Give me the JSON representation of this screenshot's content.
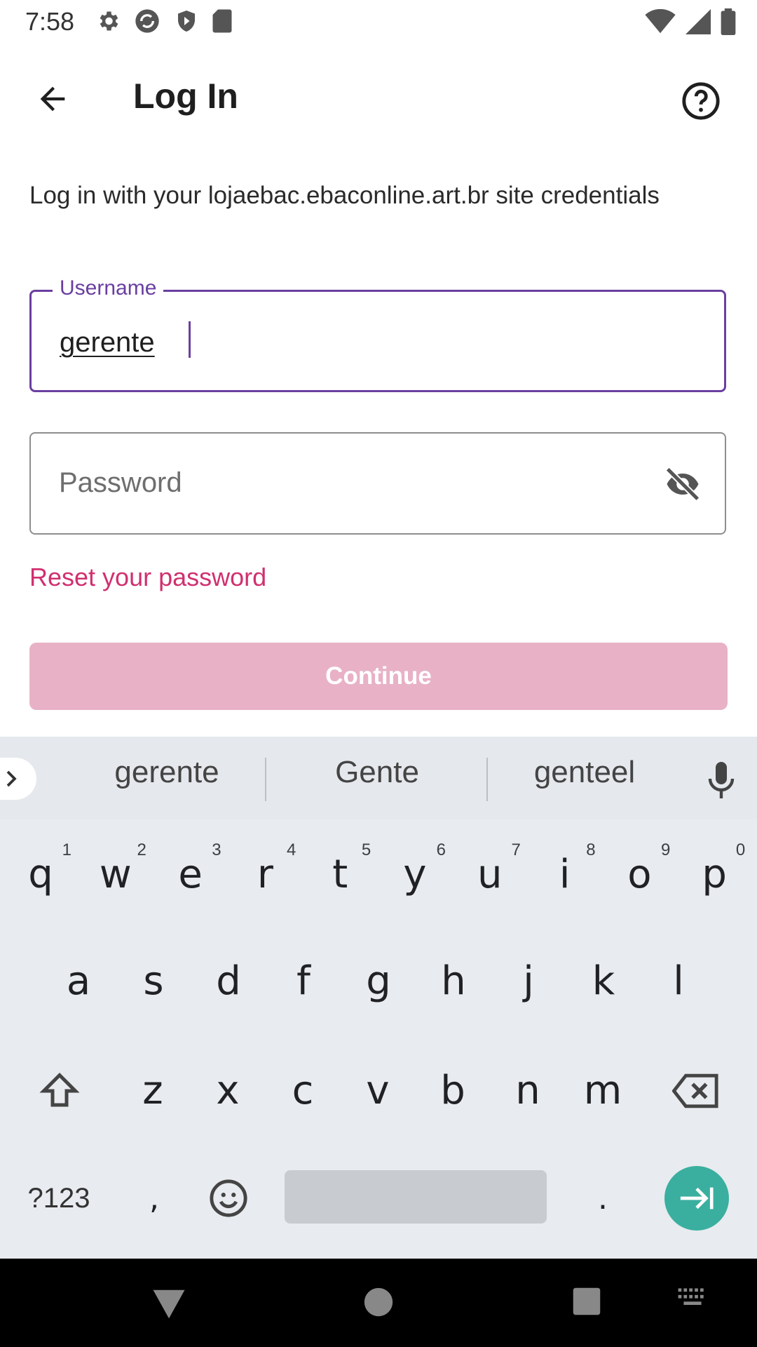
{
  "status_bar": {
    "time": "7:58",
    "left_icons": [
      "settings-gear-icon",
      "sync-icon",
      "play-protect-icon",
      "sd-card-icon"
    ],
    "right_icons": [
      "wifi-icon",
      "cell-signal-icon",
      "battery-icon"
    ]
  },
  "app_bar": {
    "title": "Log In",
    "back_icon": "arrow-back-icon",
    "help_icon": "help-circle-icon"
  },
  "intro": "Log in with your lojaebac.ebaconline.art.br site credentials",
  "username": {
    "label": "Username",
    "value": "gerente"
  },
  "password": {
    "placeholder": "Password",
    "toggle_icon": "visibility-off-icon"
  },
  "reset_link": "Reset your password",
  "continue_label": "Continue",
  "keyboard": {
    "suggestions": [
      "gerente",
      "Gente",
      "genteel"
    ],
    "row1": [
      {
        "k": "q",
        "h": "1"
      },
      {
        "k": "w",
        "h": "2"
      },
      {
        "k": "e",
        "h": "3"
      },
      {
        "k": "r",
        "h": "4"
      },
      {
        "k": "t",
        "h": "5"
      },
      {
        "k": "y",
        "h": "6"
      },
      {
        "k": "u",
        "h": "7"
      },
      {
        "k": "i",
        "h": "8"
      },
      {
        "k": "o",
        "h": "9"
      },
      {
        "k": "p",
        "h": "0"
      }
    ],
    "row2": [
      "a",
      "s",
      "d",
      "f",
      "g",
      "h",
      "j",
      "k",
      "l"
    ],
    "row3": [
      "z",
      "x",
      "c",
      "v",
      "b",
      "n",
      "m"
    ],
    "symbols_label": "?123",
    "comma": ",",
    "period": "."
  },
  "colors": {
    "accent_purple": "#6a3fa0",
    "link_pink": "#d0306f",
    "button_disabled": "#e8b1c6",
    "enter_teal": "#3aaf9f"
  }
}
